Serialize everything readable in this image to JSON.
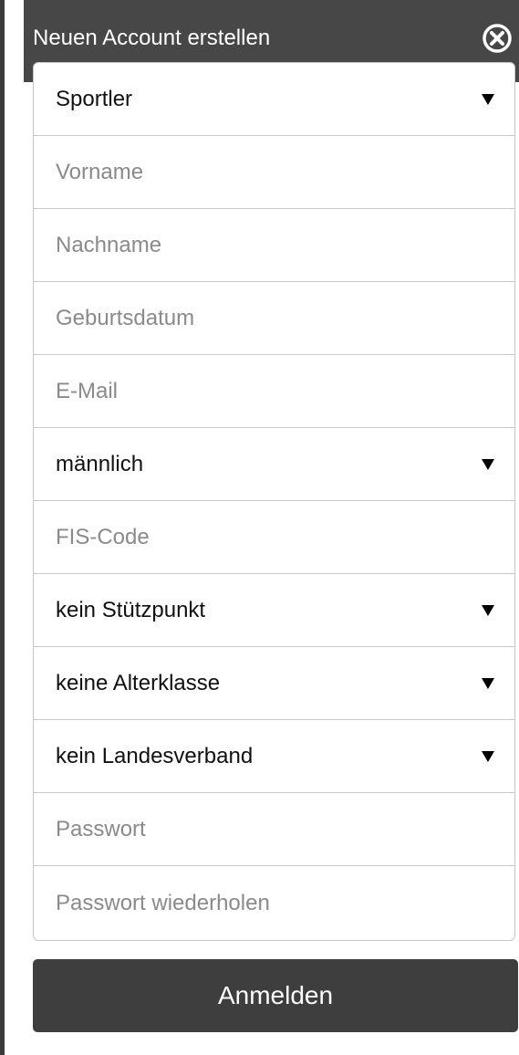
{
  "dialog": {
    "title": "Neuen Account erstellen",
    "close_icon": "close-circle-icon"
  },
  "form": {
    "role": {
      "value": "Sportler"
    },
    "first_name": {
      "placeholder": "Vorname"
    },
    "last_name": {
      "placeholder": "Nachname"
    },
    "birthdate": {
      "placeholder": "Geburtsdatum"
    },
    "email": {
      "placeholder": "E-Mail"
    },
    "gender": {
      "value": "männlich"
    },
    "fis_code": {
      "placeholder": "FIS-Code"
    },
    "base": {
      "value": "kein Stützpunkt"
    },
    "age_class": {
      "value": "keine Alterklasse"
    },
    "state_association": {
      "value": "kein Landesverband"
    },
    "password": {
      "placeholder": "Passwort"
    },
    "password_repeat": {
      "placeholder": "Passwort wiederholen"
    },
    "submit_label": "Anmelden"
  },
  "colors": {
    "header_bg": "#474747",
    "button_bg": "#3e3e3e",
    "border": "#c7c7c7",
    "placeholder": "#8a8a8a"
  }
}
